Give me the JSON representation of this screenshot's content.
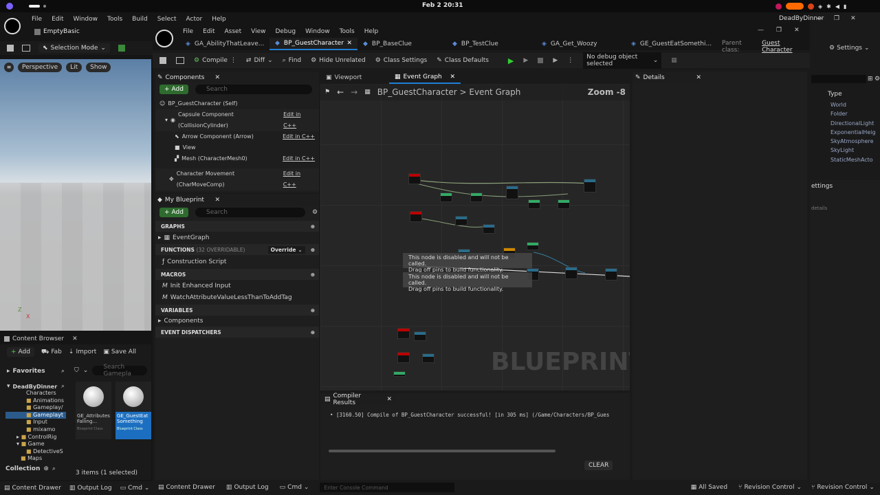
{
  "system": {
    "clock": "Feb 2  20:31"
  },
  "main_window": {
    "title": "EmptyBasic",
    "menu": [
      "File",
      "Edit",
      "Window",
      "Tools",
      "Build",
      "Select",
      "Actor",
      "Help"
    ],
    "selection_mode": "Selection Mode",
    "viewport": {
      "perspective": "Perspective",
      "lit": "Lit",
      "show": "Show"
    },
    "settings_label": "Settings",
    "outliner": {
      "type_header": "Type",
      "types": [
        "World",
        "Folder",
        "DirectionalLight",
        "ExponentialHeig",
        "SkyAtmosphere",
        "SkyLight",
        "StaticMeshActo"
      ],
      "settings_frag": "ettings",
      "details_frag": "details"
    },
    "revision_control": "Revision Control",
    "project_name": "DeadByDinner"
  },
  "content_browser": {
    "tab": "Content Browser",
    "add": "Add",
    "fab": "Fab",
    "import": "Import",
    "save_all": "Save All",
    "search_placeholder": "Search Gamepla",
    "favorites": "Favorites",
    "root": "DeadByDinner",
    "tree": [
      "Characters",
      "Animations",
      "Gameplay/",
      "Gameplayt",
      "Input",
      "mixamo",
      "ControlRig",
      "Game",
      "DetectiveS",
      "Maps"
    ],
    "assets": [
      {
        "name": "GE_Attributes Falling...",
        "kind": "Blueprint Class"
      },
      {
        "name": "GE_GuestEat Something",
        "kind": "Blueprint Class"
      }
    ],
    "collection": "Collection",
    "status": "3 items (1 selected)",
    "content_drawer": "Content Drawer",
    "output_log": "Output Log",
    "cmd": "Cmd"
  },
  "bp_editor": {
    "menu": [
      "File",
      "Edit",
      "Asset",
      "View",
      "Debug",
      "Window",
      "Tools",
      "Help"
    ],
    "tabs": [
      {
        "label": "GA_AbilityThatLeave...",
        "active": false
      },
      {
        "label": "BP_GuestCharacter",
        "active": true
      },
      {
        "label": "BP_BaseClue",
        "active": false
      },
      {
        "label": "BP_TestClue",
        "active": false
      },
      {
        "label": "GA_Get_Woozy",
        "active": false
      },
      {
        "label": "GE_GuestEatSomethi...",
        "active": false
      }
    ],
    "parent_class_label": "Parent class:",
    "parent_class_value": "Guest Character",
    "toolbar": {
      "compile": "Compile",
      "diff": "Diff",
      "find": "Find",
      "hide_unrelated": "Hide Unrelated",
      "class_settings": "Class Settings",
      "class_defaults": "Class Defaults",
      "debug_select": "No debug object selected"
    },
    "components": {
      "tab": "Components",
      "add": "Add",
      "search_placeholder": "Search",
      "items": [
        {
          "label": "BP_GuestCharacter (Self)",
          "edit": ""
        },
        {
          "label": "Capsule Component (CollisionCylinder)",
          "edit": "Edit in C++"
        },
        {
          "label": "Arrow Component (Arrow)",
          "edit": "Edit in C++"
        },
        {
          "label": "View",
          "edit": ""
        },
        {
          "label": "Mesh (CharacterMesh0)",
          "edit": "Edit in C++"
        },
        {
          "label": "Character Movement (CharMoveComp)",
          "edit": "Edit in C++"
        }
      ]
    },
    "my_blueprint": {
      "tab": "My Blueprint",
      "add": "Add",
      "search_placeholder": "Search",
      "graphs": "GRAPHS",
      "event_graph": "EventGraph",
      "functions": "FUNCTIONS",
      "functions_count": "(32 OVERRIDABLE)",
      "override": "Override",
      "construction_script": "Construction Script",
      "macros": "MACROS",
      "macro_items": [
        "Init Enhanced Input",
        "WatchAttributeValueLessThanToAddTag"
      ],
      "variables": "VARIABLES",
      "components_cat": "Components",
      "event_dispatchers": "EVENT DISPATCHERS"
    },
    "graph": {
      "viewport_tab": "Viewport",
      "event_graph_tab": "Event Graph",
      "breadcrumb_bp": "BP_GuestCharacter",
      "breadcrumb_graph": "Event Graph",
      "zoom": "Zoom -8",
      "disabled_msg_1": "This node is disabled and will not be called.",
      "disabled_msg_2": "Drag off pins to build functionality.",
      "watermark": "BLUEPRINT"
    },
    "details_tab": "Details",
    "compiler": {
      "tab": "Compiler Results",
      "message": "[3160.50] Compile of BP_GuestCharacter successful! [in 305 ms] (/Game/Characters/BP_Gues",
      "clear": "CLEAR"
    },
    "bottom": {
      "content_drawer": "Content Drawer",
      "output_log": "Output Log",
      "cmd": "Cmd",
      "console_placeholder": "Enter Console Command",
      "all_saved": "All Saved",
      "revision_control": "Revision Control"
    }
  }
}
